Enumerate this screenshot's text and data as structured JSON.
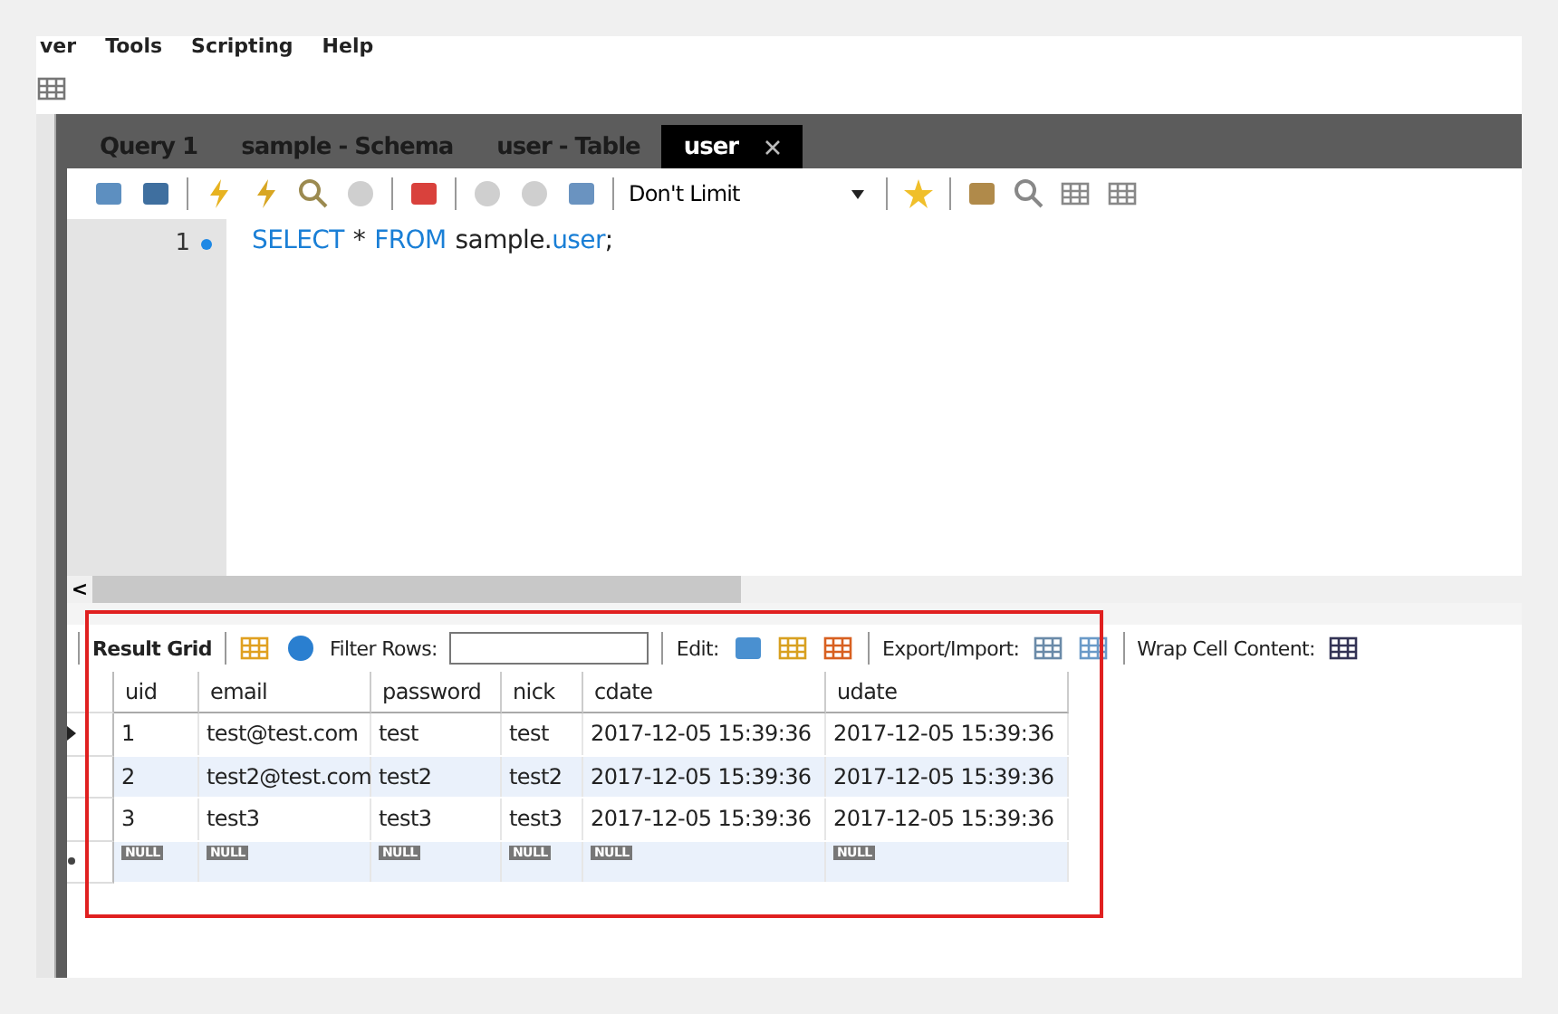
{
  "menu": [
    "ver",
    "Tools",
    "Scripting",
    "Help"
  ],
  "tabs": [
    {
      "label": "Query 1",
      "selected": false,
      "closable": false
    },
    {
      "label": "sample - Schema",
      "selected": false,
      "closable": false
    },
    {
      "label": "user - Table",
      "selected": false,
      "closable": false
    },
    {
      "label": "user",
      "selected": true,
      "closable": true
    }
  ],
  "editor_toolbar": {
    "limit": "Don't Limit"
  },
  "editor": {
    "line_number": "1",
    "breakpoint": true,
    "tokens": [
      {
        "text": "SELECT",
        "kind": "keyword"
      },
      {
        "text": "*",
        "kind": "plain"
      },
      {
        "text": "FROM",
        "kind": "keyword"
      },
      {
        "text": "sample.",
        "kind": "plain"
      },
      {
        "text": "user",
        "kind": "keyword"
      },
      {
        "text": ";",
        "kind": "plain"
      }
    ]
  },
  "scrollbar_arrow": "<",
  "result_toolbar": {
    "result_grid": "Result Grid",
    "filter_label": "Filter Rows:",
    "edit_label": "Edit:",
    "export_label": "Export/Import:",
    "wrap_label": "Wrap Cell Content:"
  },
  "table": {
    "columns": [
      "uid",
      "email",
      "password",
      "nick",
      "cdate",
      "udate"
    ],
    "rows": [
      {
        "selected": true,
        "new": false,
        "cells": [
          "1",
          "test@test.com",
          "test",
          "test",
          "2017-12-05 15:39:36",
          "2017-12-05 15:39:36"
        ]
      },
      {
        "selected": false,
        "new": false,
        "cells": [
          "2",
          "test2@test.com",
          "test2",
          "test2",
          "2017-12-05 15:39:36",
          "2017-12-05 15:39:36"
        ]
      },
      {
        "selected": false,
        "new": false,
        "cells": [
          "3",
          "test3",
          "test3",
          "test3",
          "2017-12-05 15:39:36",
          "2017-12-05 15:39:36"
        ]
      },
      {
        "selected": false,
        "new": true,
        "cells": [
          "NULL",
          "NULL",
          "NULL",
          "NULL",
          "NULL",
          "NULL"
        ]
      }
    ]
  },
  "annotation": {
    "visible": true,
    "color": "#e02020"
  }
}
